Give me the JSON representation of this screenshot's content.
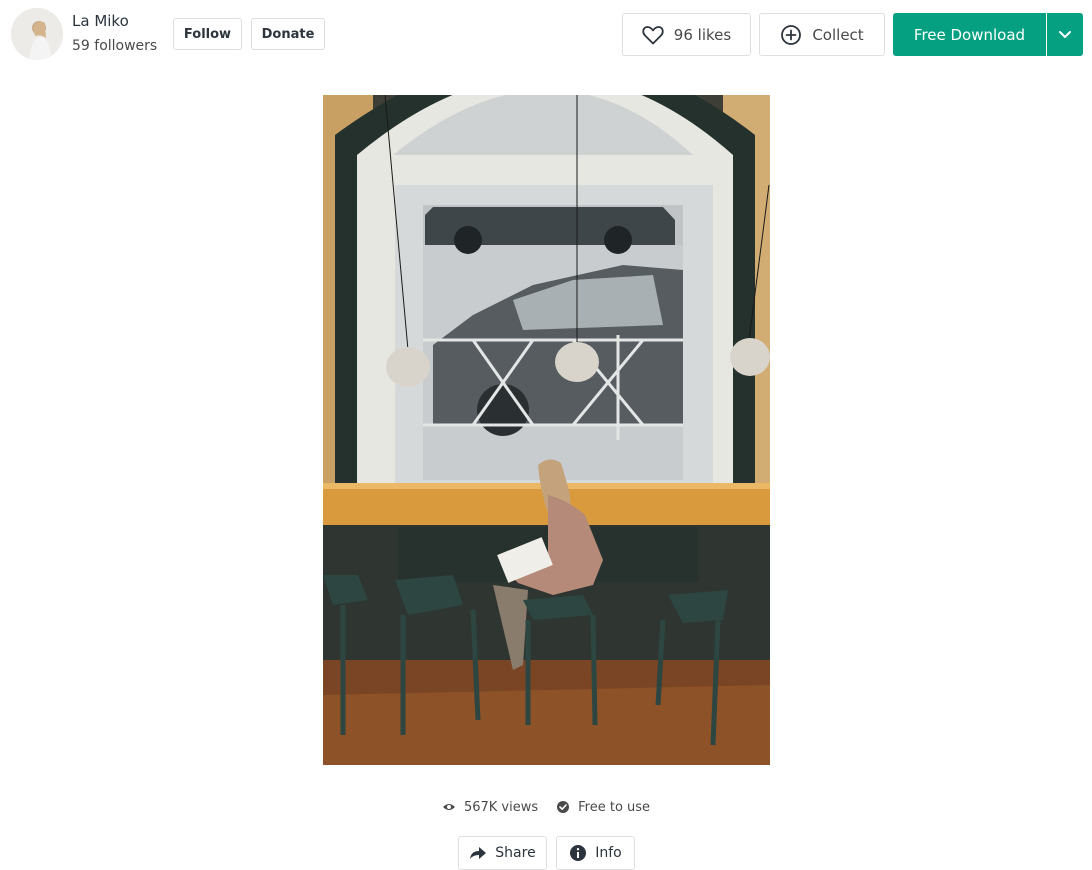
{
  "author": {
    "name": "La Miko",
    "followers": "59 followers",
    "avatar_icon": "author-avatar"
  },
  "header": {
    "follow_label": "Follow",
    "donate_label": "Donate",
    "likes_label": "96 likes",
    "collect_label": "Collect",
    "download_label": "Free Download",
    "icons": {
      "like": "heart-icon",
      "collect": "plus-circle-icon",
      "download_more": "chevron-down-icon"
    }
  },
  "photo": {
    "subject_icon": "photo-woman-reading-at-window"
  },
  "meta": {
    "views": "567K views",
    "license": "Free to use"
  },
  "actions": {
    "share_label": "Share",
    "info_label": "Info"
  },
  "colors": {
    "accent": "#05a081",
    "text": "#2c343e",
    "border": "#dfdfe0"
  }
}
